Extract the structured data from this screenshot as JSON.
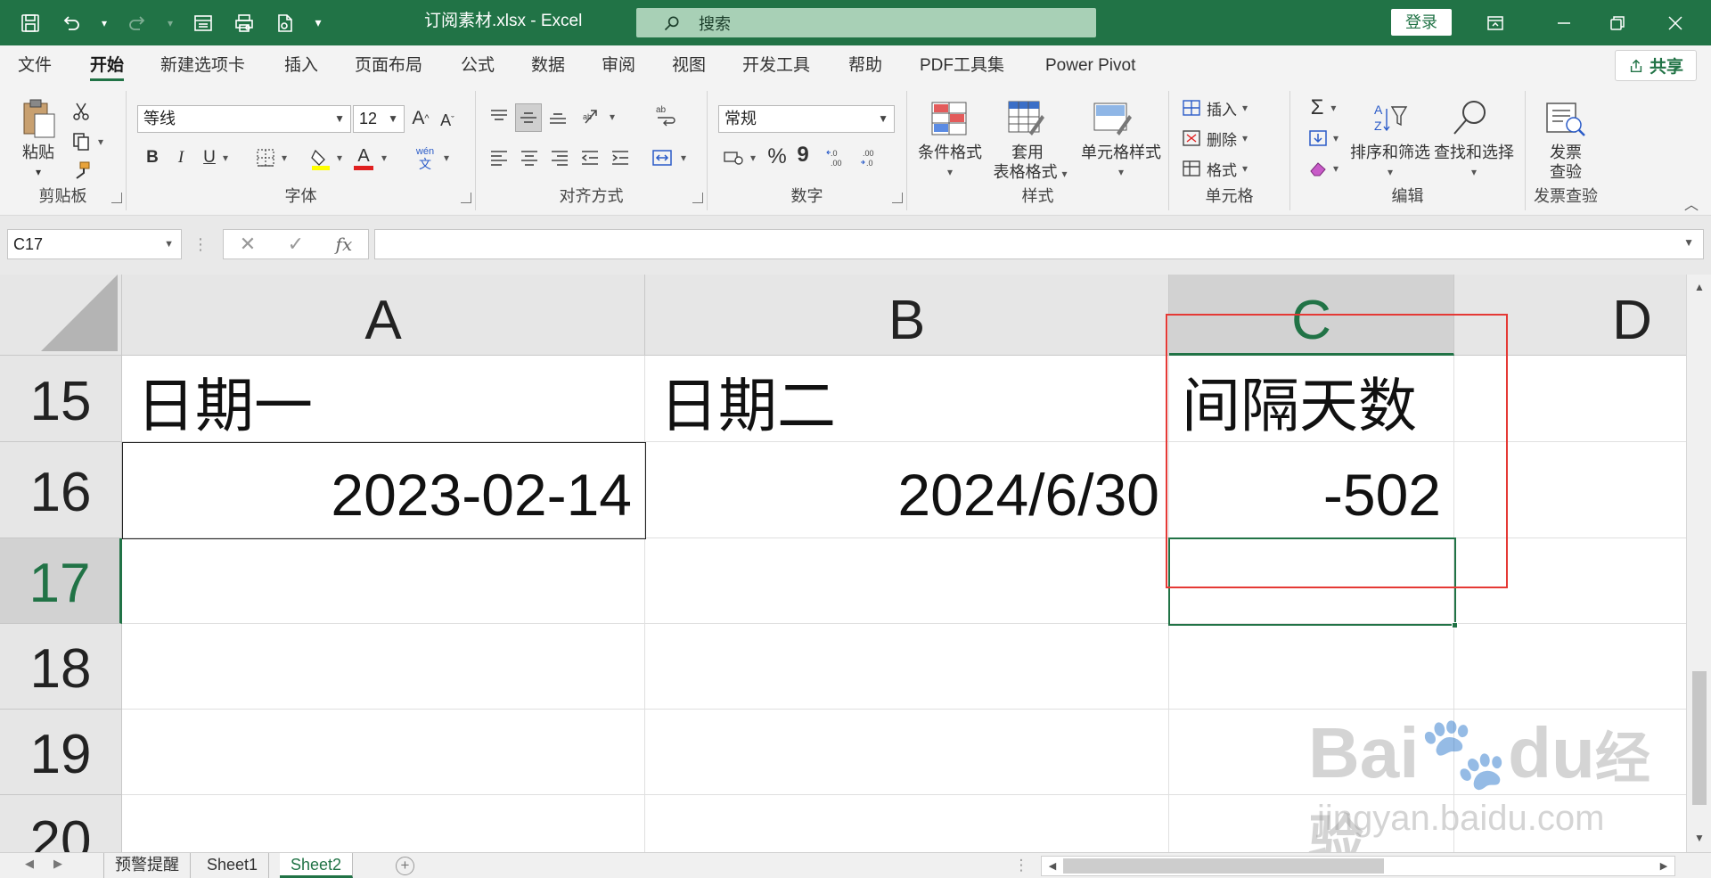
{
  "window": {
    "title": "订阅素材.xlsx  -  Excel",
    "search_placeholder": "搜索",
    "login_label": "登录"
  },
  "menu": {
    "tabs": [
      "文件",
      "开始",
      "新建选项卡",
      "插入",
      "页面布局",
      "公式",
      "数据",
      "审阅",
      "视图",
      "开发工具",
      "帮助",
      "PDF工具集",
      "Power Pivot"
    ],
    "active_tab": "开始",
    "share_label": "共享"
  },
  "ribbon": {
    "clipboard": {
      "label": "剪贴板",
      "paste": "粘贴"
    },
    "font": {
      "label": "字体",
      "font_name": "等线",
      "font_size": "12",
      "bold": "B",
      "italic": "I",
      "underline": "U",
      "grow": "A",
      "shrink": "A",
      "font_color": "A",
      "phonetic_top": "wén",
      "phonetic_bottom": "文"
    },
    "alignment": {
      "label": "对齐方式"
    },
    "number": {
      "label": "数字",
      "format": "常规",
      "percent": "%",
      "comma": "9"
    },
    "styles": {
      "label": "样式",
      "conditional": "条件格式",
      "table_line1": "套用",
      "table_line2": "表格格式",
      "cell_styles": "单元格样式"
    },
    "cells": {
      "label": "单元格",
      "insert": "插入",
      "delete": "删除",
      "format": "格式"
    },
    "editing": {
      "label": "编辑",
      "sum": "Σ",
      "sort_filter": "排序和筛选",
      "find_select": "查找和选择"
    },
    "invoice": {
      "label": "发票查验",
      "btn_line1": "发票",
      "btn_line2": "查验"
    }
  },
  "formula_bar": {
    "name_box": "C17",
    "cancel": "✕",
    "enter": "✓",
    "fx": "fx",
    "formula": ""
  },
  "sheet": {
    "columns": [
      "A",
      "B",
      "C",
      "D"
    ],
    "selected_column": "C",
    "rows": [
      15,
      16,
      17,
      18,
      19,
      20
    ],
    "selected_row": 17,
    "row15": {
      "A": "日期一",
      "B": "日期二",
      "C": "间隔天数"
    },
    "row16": {
      "A": "2023-02-14",
      "B": "2024/6/30",
      "C": "-502"
    }
  },
  "sheet_tabs": {
    "tabs": [
      "预警提醒",
      "Sheet1",
      "Sheet2"
    ],
    "active": "Sheet2",
    "add": "+"
  },
  "watermark": {
    "logo": "Bai",
    "logo2": "du",
    "brand": "经验",
    "url": "jingyan.baidu.com"
  },
  "colors": {
    "excel_green": "#217346",
    "highlight_red": "#e53935"
  }
}
